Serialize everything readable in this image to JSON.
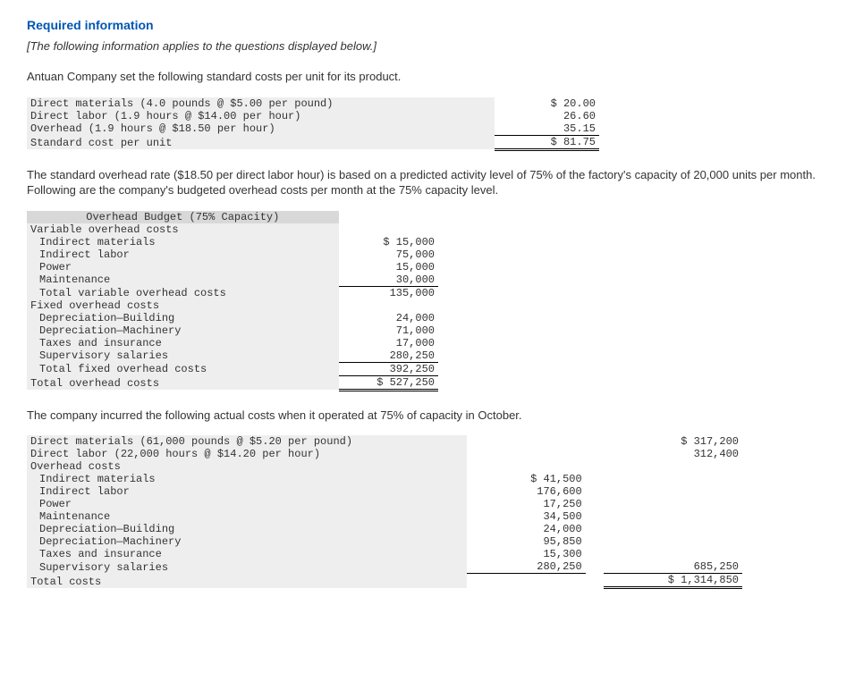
{
  "header": {
    "title": "Required information",
    "note": "[The following information applies to the questions displayed below.]"
  },
  "intro_text": "Antuan Company set the following standard costs per unit for its product.",
  "std_cost": {
    "dm_label": "Direct materials (4.0 pounds @ $5.00 per pound)",
    "dm_val": "$ 20.00",
    "dl_label": "Direct labor (1.9 hours @ $14.00 per hour)",
    "dl_val": "26.60",
    "oh_label": "Overhead (1.9 hours @ $18.50 per hour)",
    "oh_val": "35.15",
    "total_label": "Standard cost per unit",
    "total_val": "$ 81.75"
  },
  "para2": "The standard overhead rate ($18.50 per direct labor hour) is based on a predicted activity level of 75% of the factory's capacity of 20,000 units per month. Following are the company's budgeted overhead costs per month at the 75% capacity level.",
  "budget": {
    "title": "Overhead Budget (75% Capacity)",
    "var_head": "Variable overhead costs",
    "im_label": "Indirect materials",
    "im_val": "$ 15,000",
    "il_label": "Indirect labor",
    "il_val": "75,000",
    "pw_label": "Power",
    "pw_val": "15,000",
    "mt_label": "Maintenance",
    "mt_val": "30,000",
    "tvar_label": "Total variable overhead costs",
    "tvar_val": "135,000",
    "fix_head": "Fixed overhead costs",
    "db_label": "Depreciation—Building",
    "db_val": "24,000",
    "dm_label": "Depreciation—Machinery",
    "dm_val": "71,000",
    "ti_label": "Taxes and insurance",
    "ti_val": "17,000",
    "ss_label": "Supervisory salaries",
    "ss_val": "280,250",
    "tfix_label": "Total fixed overhead costs",
    "tfix_val": "392,250",
    "tot_label": "Total overhead costs",
    "tot_val": "$ 527,250"
  },
  "para3": "The company incurred the following actual costs when it operated at 75% of capacity in October.",
  "actual": {
    "dm_label": "Direct materials (61,000 pounds @ $5.20 per pound)",
    "dm_val": "$ 317,200",
    "dl_label": "Direct labor (22,000 hours @ $14.20 per hour)",
    "dl_val": "312,400",
    "oh_head": "Overhead costs",
    "im_label": "Indirect materials",
    "im_val": "$ 41,500",
    "il_label": "Indirect labor",
    "il_val": "176,600",
    "pw_label": "Power",
    "pw_val": "17,250",
    "mt_label": "Maintenance",
    "mt_val": "34,500",
    "db_label": "Depreciation—Building",
    "db_val": "24,000",
    "dmc_label": "Depreciation—Machinery",
    "dmc_val": "95,850",
    "ti_label": "Taxes and insurance",
    "ti_val": "15,300",
    "ss_label": "Supervisory salaries",
    "ss_val": "280,250",
    "oh_sum": "685,250",
    "tot_label": "Total costs",
    "tot_val": "$ 1,314,850"
  }
}
